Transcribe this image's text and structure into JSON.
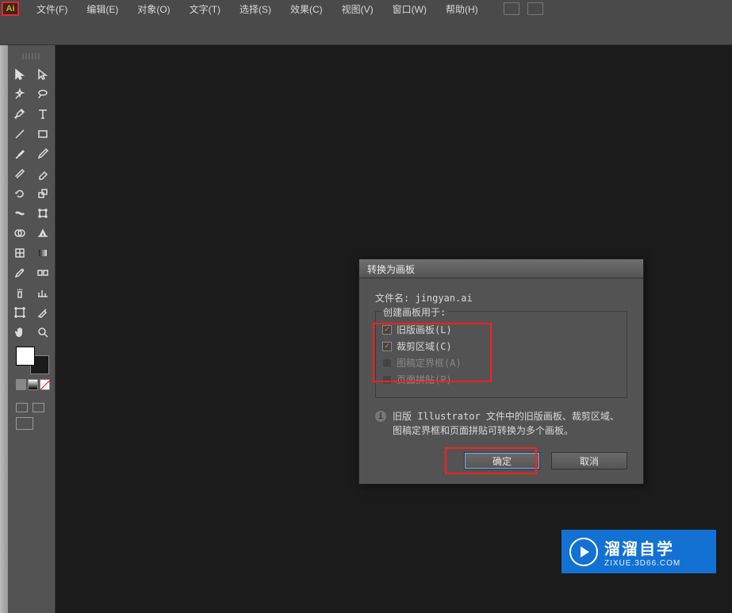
{
  "menu": {
    "file": "文件(F)",
    "edit": "编辑(E)",
    "object": "对象(O)",
    "type": "文字(T)",
    "select": "选择(S)",
    "effect": "效果(C)",
    "view": "视图(V)",
    "window": "窗口(W)",
    "help": "帮助(H)"
  },
  "dialog": {
    "title": "转换为画板",
    "filename_label": "文件名:",
    "filename_value": "jingyan.ai",
    "legend": "创建画板用于:",
    "opt_legacy": "旧版画板(L)",
    "opt_crop": "裁剪区域(C)",
    "opt_bbox": "图稿定界框(A)",
    "opt_tile": "页面拼贴(P)",
    "info": "旧版 Illustrator 文件中的旧版画板、裁剪区域、图稿定界框和页面拼贴可转换为多个画板。",
    "ok": "确定",
    "cancel": "取消"
  },
  "watermark": {
    "title": "溜溜自学",
    "sub": "ZIXUE.3D66.COM"
  },
  "tools": {
    "selection": "selection-tool",
    "direct": "direct-selection-tool",
    "wand": "magic-wand-tool",
    "lasso": "lasso-tool",
    "pen": "pen-tool",
    "type": "type-tool",
    "line": "line-tool",
    "rect": "rectangle-tool",
    "brush": "paintbrush-tool",
    "pencil": "pencil-tool",
    "blob": "blob-brush-tool",
    "eraser": "eraser-tool",
    "rotate": "rotate-tool",
    "scale": "scale-tool",
    "width": "width-tool",
    "free": "free-transform-tool",
    "shape": "shape-builder-tool",
    "persp": "perspective-grid-tool",
    "mesh": "mesh-tool",
    "gradient": "gradient-tool",
    "eyedrop": "eyedropper-tool",
    "blend": "blend-tool",
    "spray": "symbol-sprayer-tool",
    "graph": "column-graph-tool",
    "artboard": "artboard-tool",
    "slice": "slice-tool",
    "hand": "hand-tool",
    "zoom": "zoom-tool"
  }
}
